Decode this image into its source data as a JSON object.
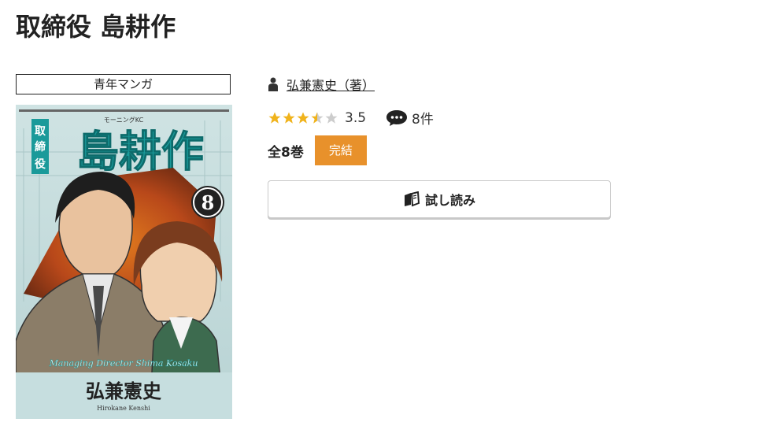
{
  "title": "取締役 島耕作",
  "genre": "青年マンガ",
  "author": {
    "label": "弘兼憲史（著）"
  },
  "rating": {
    "value": "3.5",
    "stars": 3.5,
    "max": 5
  },
  "reviews": {
    "count_label": "8件"
  },
  "volumes": {
    "label": "全8巻"
  },
  "status_badge": "完結",
  "preview_button": {
    "label": "試し読み"
  },
  "cover": {
    "series_label": "モーニングKC",
    "title_small": "取締役",
    "title_large": "島耕作",
    "volume_number": "8",
    "subtitle_roman": "Managing Director Shima Kosaku",
    "author_jp": "弘兼憲史",
    "author_roman": "Hirokane Kenshi"
  },
  "colors": {
    "accent_orange": "#e8912b",
    "star_gold": "#f0b31c",
    "star_empty": "#cccccc",
    "cover_teal": "#1a9a9a"
  }
}
